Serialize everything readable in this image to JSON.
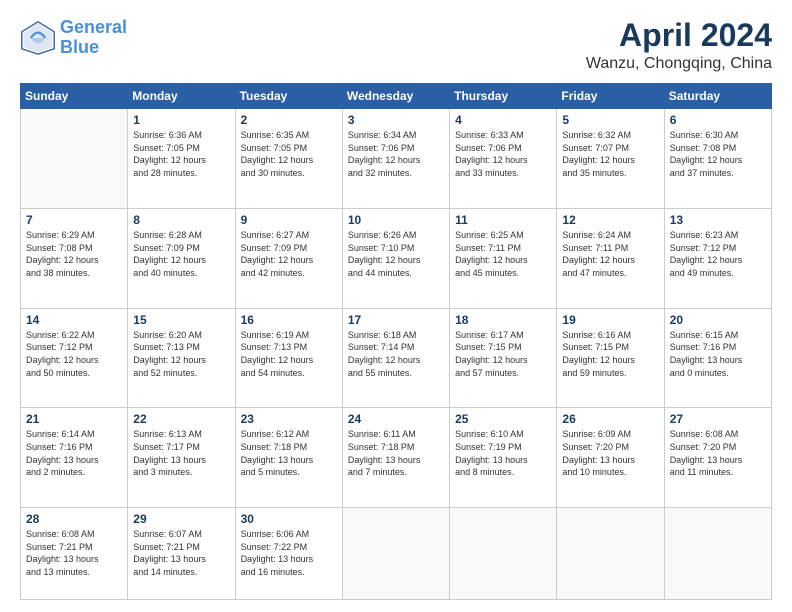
{
  "header": {
    "logo_line1": "General",
    "logo_line2": "Blue",
    "month_year": "April 2024",
    "location": "Wanzu, Chongqing, China"
  },
  "weekdays": [
    "Sunday",
    "Monday",
    "Tuesday",
    "Wednesday",
    "Thursday",
    "Friday",
    "Saturday"
  ],
  "weeks": [
    [
      {
        "day": "",
        "info": ""
      },
      {
        "day": "1",
        "info": "Sunrise: 6:36 AM\nSunset: 7:05 PM\nDaylight: 12 hours\nand 28 minutes."
      },
      {
        "day": "2",
        "info": "Sunrise: 6:35 AM\nSunset: 7:05 PM\nDaylight: 12 hours\nand 30 minutes."
      },
      {
        "day": "3",
        "info": "Sunrise: 6:34 AM\nSunset: 7:06 PM\nDaylight: 12 hours\nand 32 minutes."
      },
      {
        "day": "4",
        "info": "Sunrise: 6:33 AM\nSunset: 7:06 PM\nDaylight: 12 hours\nand 33 minutes."
      },
      {
        "day": "5",
        "info": "Sunrise: 6:32 AM\nSunset: 7:07 PM\nDaylight: 12 hours\nand 35 minutes."
      },
      {
        "day": "6",
        "info": "Sunrise: 6:30 AM\nSunset: 7:08 PM\nDaylight: 12 hours\nand 37 minutes."
      }
    ],
    [
      {
        "day": "7",
        "info": "Sunrise: 6:29 AM\nSunset: 7:08 PM\nDaylight: 12 hours\nand 38 minutes."
      },
      {
        "day": "8",
        "info": "Sunrise: 6:28 AM\nSunset: 7:09 PM\nDaylight: 12 hours\nand 40 minutes."
      },
      {
        "day": "9",
        "info": "Sunrise: 6:27 AM\nSunset: 7:09 PM\nDaylight: 12 hours\nand 42 minutes."
      },
      {
        "day": "10",
        "info": "Sunrise: 6:26 AM\nSunset: 7:10 PM\nDaylight: 12 hours\nand 44 minutes."
      },
      {
        "day": "11",
        "info": "Sunrise: 6:25 AM\nSunset: 7:11 PM\nDaylight: 12 hours\nand 45 minutes."
      },
      {
        "day": "12",
        "info": "Sunrise: 6:24 AM\nSunset: 7:11 PM\nDaylight: 12 hours\nand 47 minutes."
      },
      {
        "day": "13",
        "info": "Sunrise: 6:23 AM\nSunset: 7:12 PM\nDaylight: 12 hours\nand 49 minutes."
      }
    ],
    [
      {
        "day": "14",
        "info": "Sunrise: 6:22 AM\nSunset: 7:12 PM\nDaylight: 12 hours\nand 50 minutes."
      },
      {
        "day": "15",
        "info": "Sunrise: 6:20 AM\nSunset: 7:13 PM\nDaylight: 12 hours\nand 52 minutes."
      },
      {
        "day": "16",
        "info": "Sunrise: 6:19 AM\nSunset: 7:13 PM\nDaylight: 12 hours\nand 54 minutes."
      },
      {
        "day": "17",
        "info": "Sunrise: 6:18 AM\nSunset: 7:14 PM\nDaylight: 12 hours\nand 55 minutes."
      },
      {
        "day": "18",
        "info": "Sunrise: 6:17 AM\nSunset: 7:15 PM\nDaylight: 12 hours\nand 57 minutes."
      },
      {
        "day": "19",
        "info": "Sunrise: 6:16 AM\nSunset: 7:15 PM\nDaylight: 12 hours\nand 59 minutes."
      },
      {
        "day": "20",
        "info": "Sunrise: 6:15 AM\nSunset: 7:16 PM\nDaylight: 13 hours\nand 0 minutes."
      }
    ],
    [
      {
        "day": "21",
        "info": "Sunrise: 6:14 AM\nSunset: 7:16 PM\nDaylight: 13 hours\nand 2 minutes."
      },
      {
        "day": "22",
        "info": "Sunrise: 6:13 AM\nSunset: 7:17 PM\nDaylight: 13 hours\nand 3 minutes."
      },
      {
        "day": "23",
        "info": "Sunrise: 6:12 AM\nSunset: 7:18 PM\nDaylight: 13 hours\nand 5 minutes."
      },
      {
        "day": "24",
        "info": "Sunrise: 6:11 AM\nSunset: 7:18 PM\nDaylight: 13 hours\nand 7 minutes."
      },
      {
        "day": "25",
        "info": "Sunrise: 6:10 AM\nSunset: 7:19 PM\nDaylight: 13 hours\nand 8 minutes."
      },
      {
        "day": "26",
        "info": "Sunrise: 6:09 AM\nSunset: 7:20 PM\nDaylight: 13 hours\nand 10 minutes."
      },
      {
        "day": "27",
        "info": "Sunrise: 6:08 AM\nSunset: 7:20 PM\nDaylight: 13 hours\nand 11 minutes."
      }
    ],
    [
      {
        "day": "28",
        "info": "Sunrise: 6:08 AM\nSunset: 7:21 PM\nDaylight: 13 hours\nand 13 minutes."
      },
      {
        "day": "29",
        "info": "Sunrise: 6:07 AM\nSunset: 7:21 PM\nDaylight: 13 hours\nand 14 minutes."
      },
      {
        "day": "30",
        "info": "Sunrise: 6:06 AM\nSunset: 7:22 PM\nDaylight: 13 hours\nand 16 minutes."
      },
      {
        "day": "",
        "info": ""
      },
      {
        "day": "",
        "info": ""
      },
      {
        "day": "",
        "info": ""
      },
      {
        "day": "",
        "info": ""
      }
    ]
  ]
}
